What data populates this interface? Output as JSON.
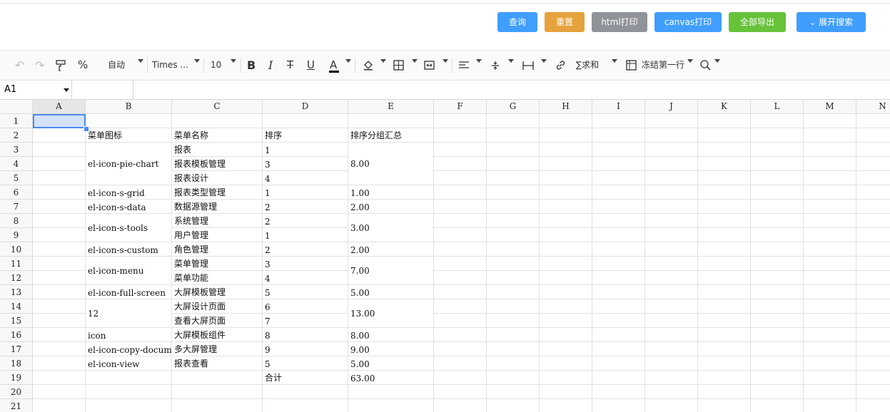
{
  "top_buttons": {
    "query": "查询",
    "reset": "重置",
    "html_print": "html打印",
    "canvas_print": "canvas打印",
    "export_all": "全部导出",
    "expand_search": "展开搜索"
  },
  "toolbar": {
    "percent": "%",
    "number_format": "自动",
    "font_family": "Times ...",
    "font_size": "10",
    "bold": "B",
    "italic": "I",
    "strike": "T",
    "underline": "U",
    "text_color": "A",
    "sum": "∑求和",
    "freeze": "冻结第一行"
  },
  "formula_bar": {
    "cell_ref": "A1",
    "formula": ""
  },
  "sheet": {
    "columns": [
      "A",
      "B",
      "C",
      "D",
      "E",
      "F",
      "G",
      "H",
      "I",
      "J",
      "K",
      "L",
      "M",
      "N"
    ],
    "rows": [
      "1",
      "2",
      "3",
      "4",
      "5",
      "6",
      "7",
      "8",
      "9",
      "10",
      "11",
      "12",
      "13",
      "14",
      "15",
      "16",
      "17",
      "18",
      "19",
      "20",
      "21"
    ],
    "header": [
      "菜单图标",
      "菜单名称",
      "排序",
      "排序分组汇总"
    ],
    "icons": [
      "el-icon-pie-chart",
      "el-icon-s-grid",
      "el-icon-s-data",
      "el-icon-s-tools",
      "el-icon-s-custom",
      "el-icon-menu",
      "el-icon-full-screen",
      "12",
      "icon",
      "el-icon-copy-document",
      "el-icon-view"
    ],
    "names": [
      "报表",
      "报表模板管理",
      "报表设计",
      "报表类型管理",
      "数据源管理",
      "系统管理",
      "用户管理",
      "角色管理",
      "菜单管理",
      "菜单功能",
      "大屏模板管理",
      "大屏设计页面",
      "查看大屏页面",
      "大屏模板组件",
      "多大屏管理",
      "报表查看"
    ],
    "orders": [
      "1",
      "3",
      "4",
      "1",
      "2",
      "2",
      "1",
      "2",
      "3",
      "4",
      "5",
      "6",
      "7",
      "8",
      "9",
      "5"
    ],
    "totals": [
      "8.00",
      "1.00",
      "2.00",
      "3.00",
      "2.00",
      "7.00",
      "5.00",
      "13.00",
      "8.00",
      "9.00",
      "5.00"
    ],
    "footer_label": "合计",
    "footer_value": "63.00"
  }
}
